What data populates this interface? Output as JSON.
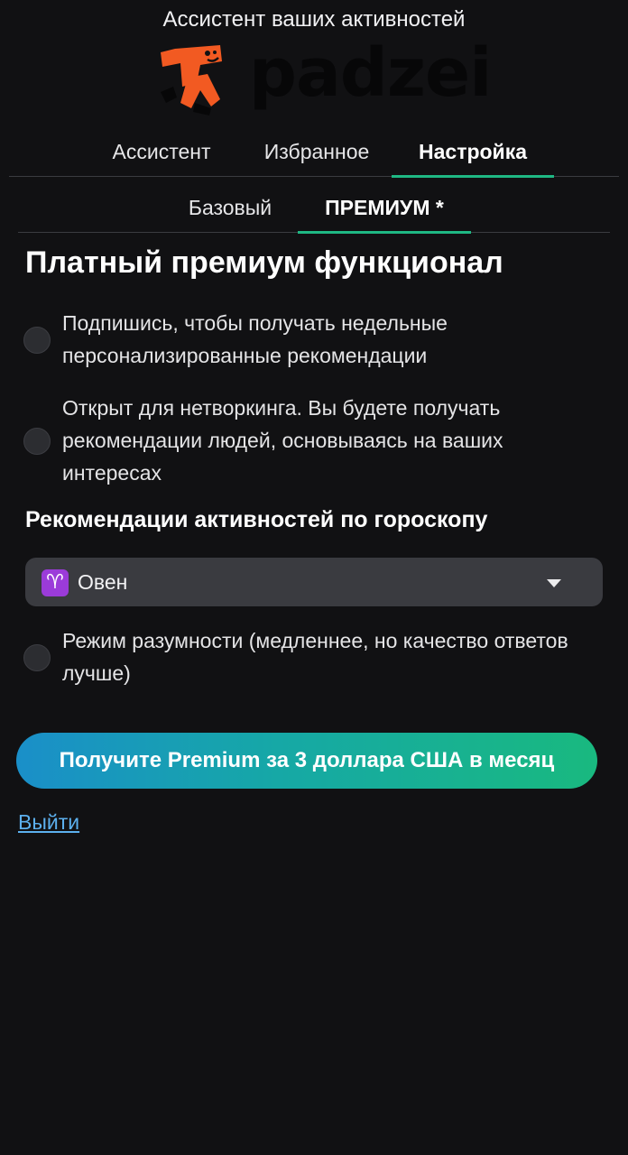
{
  "header": {
    "tagline": "Ассистент ваших активностей",
    "logo_text": "padzei",
    "logo_colors": {
      "mark": "#f25a22",
      "text": "#070708"
    }
  },
  "tabs": [
    {
      "label": "Ассистент",
      "active": false
    },
    {
      "label": "Избранное",
      "active": false
    },
    {
      "label": "Настройка",
      "active": true
    }
  ],
  "subtabs": [
    {
      "label": "Базовый",
      "active": false
    },
    {
      "label": "ПРЕМИУМ *",
      "active": true
    }
  ],
  "section": {
    "title": "Платный премиум функционал",
    "options": [
      {
        "label": "Подпишись, чтобы получать недельные персонализированные рекомендации",
        "checked": false
      },
      {
        "label": "Открыт для нетворкинга. Вы будете получать рекомендации людей, основываясь на ваших интересах",
        "checked": false
      }
    ]
  },
  "horoscope": {
    "title": "Рекомендации активностей по гороскопу",
    "sign_icon": "♈",
    "selected": "Овен",
    "icon_name": "aries-icon"
  },
  "smart_mode": {
    "label": "Режим разумности (медленнее, но качество ответов лучше)",
    "checked": false
  },
  "premium_button": {
    "label": "Получите Premium за 3 доллара США в месяц"
  },
  "logout_link": "Выйти",
  "colors": {
    "background": "#111113",
    "accent": "#1fb884",
    "link": "#5cb0ee",
    "gradient_start": "#1a8fc9",
    "gradient_end": "#19b97f"
  }
}
